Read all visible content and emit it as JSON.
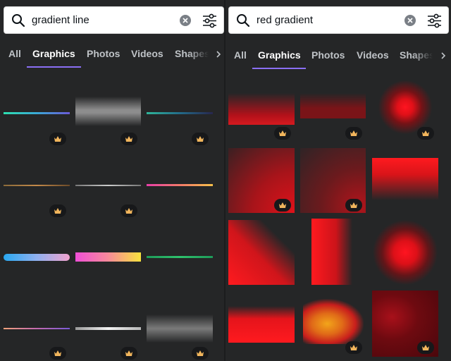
{
  "colors": {
    "background": "#252627",
    "active_tab_underline": "#8b6ff5",
    "crown": "#f1b55c"
  },
  "left": {
    "search": {
      "query": "gradient line",
      "search_icon": "search-icon",
      "clear_icon": "clear-icon",
      "filter_icon": "filter-icon"
    },
    "tabs": [
      {
        "label": "All"
      },
      {
        "label": "Graphics",
        "active": true
      },
      {
        "label": "Photos"
      },
      {
        "label": "Videos"
      },
      {
        "label": "Shapes"
      }
    ],
    "items": [
      {
        "kind": "teal-purple line",
        "premium": true
      },
      {
        "kind": "gray glow bar",
        "premium": true
      },
      {
        "kind": "teal-navy line",
        "premium": true
      },
      {
        "kind": "bronze line",
        "premium": true
      },
      {
        "kind": "silver line",
        "premium": true
      },
      {
        "kind": "pink-yellow line",
        "premium": true
      },
      {
        "kind": "blue-pink pill",
        "premium": false
      },
      {
        "kind": "magenta-yellow bar",
        "premium": false
      },
      {
        "kind": "green line",
        "premium": false
      },
      {
        "kind": "peach-purple line",
        "premium": true
      },
      {
        "kind": "chrome line",
        "premium": true
      },
      {
        "kind": "gray fog bar",
        "premium": true
      }
    ]
  },
  "right": {
    "search": {
      "query": "red gradient",
      "search_icon": "search-icon",
      "clear_icon": "clear-icon",
      "filter_icon": "filter-icon"
    },
    "tabs": [
      {
        "label": "All"
      },
      {
        "label": "Graphics",
        "active": true
      },
      {
        "label": "Photos"
      },
      {
        "label": "Videos"
      },
      {
        "label": "Shapes"
      }
    ],
    "items": [
      {
        "kind": "red fade band",
        "premium": true
      },
      {
        "kind": "dark red band",
        "premium": true
      },
      {
        "kind": "red glow orb",
        "premium": true
      },
      {
        "kind": "red corner square",
        "premium": true
      },
      {
        "kind": "dark red square",
        "premium": true
      },
      {
        "kind": "red top fade",
        "premium": false
      },
      {
        "kind": "red diagonal",
        "premium": false
      },
      {
        "kind": "red vertical",
        "premium": false
      },
      {
        "kind": "red orb",
        "premium": false
      },
      {
        "kind": "red bar",
        "premium": false
      },
      {
        "kind": "orange-red blob",
        "premium": true
      },
      {
        "kind": "dark red texture",
        "premium": true
      }
    ]
  }
}
